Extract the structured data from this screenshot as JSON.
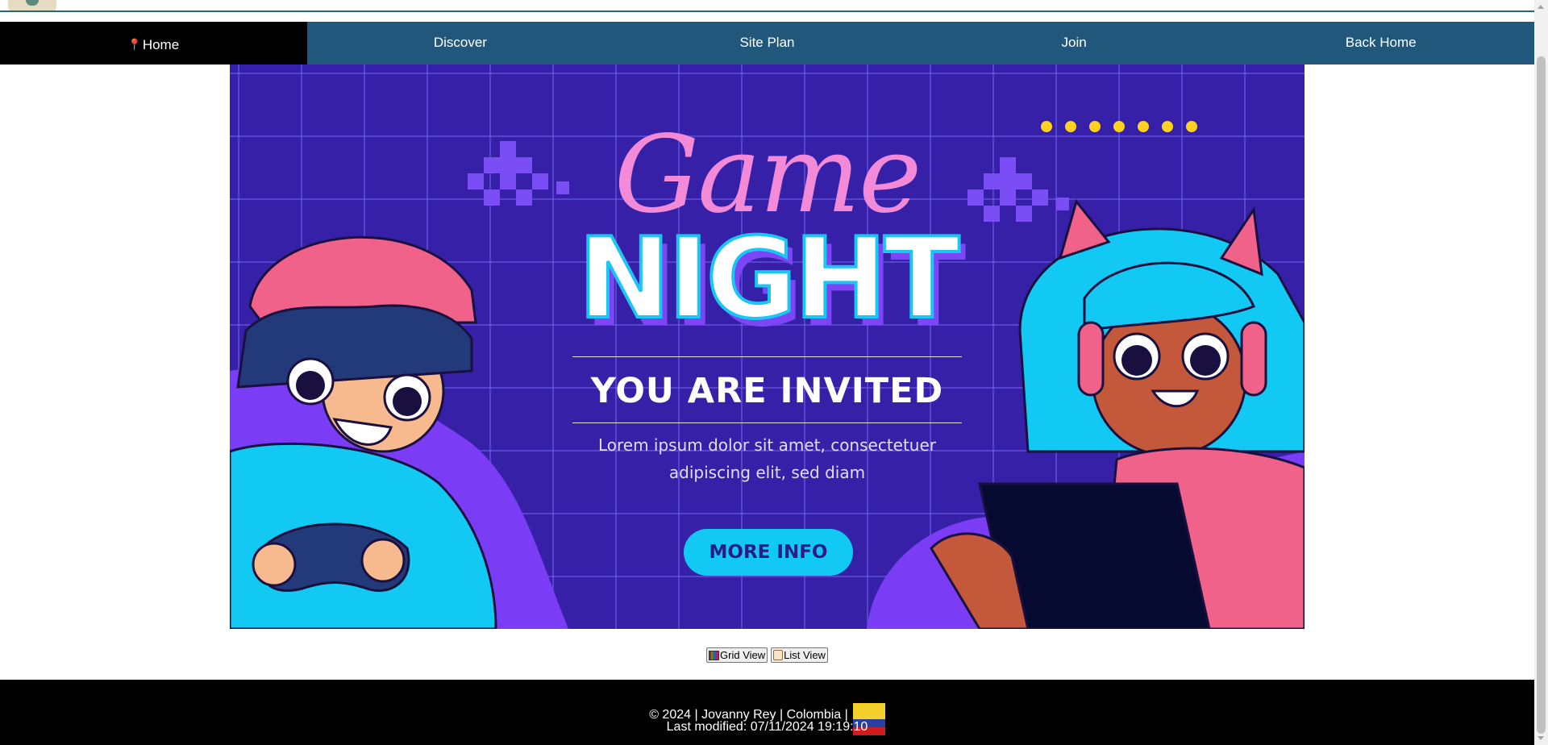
{
  "nav": {
    "items": [
      {
        "label": "Home",
        "active": true,
        "icon": "pin-icon"
      },
      {
        "label": "Discover"
      },
      {
        "label": "Site Plan"
      },
      {
        "label": "Join"
      },
      {
        "label": "Back Home"
      }
    ]
  },
  "hero": {
    "title_script": "Game",
    "title_main": "NIGHT",
    "subtitle": "YOU ARE INVITED",
    "body": "Lorem ipsum dolor sit amet, consectetuer adipiscing elit, sed diam",
    "button": "MORE INFO",
    "colors": {
      "background": "#3620a8",
      "accent_pink": "#f28ad8",
      "accent_cyan": "#12c9f4",
      "accent_purple": "#7c45f5"
    }
  },
  "view_controls": {
    "grid_label": "Grid View",
    "list_label": "List View"
  },
  "footer": {
    "copyright": "© 2024 | Jovanny Rey | Colombia |",
    "last_modified": "Last modified: 07/11/2024 19:19:10",
    "flag": "colombia-flag-icon"
  }
}
